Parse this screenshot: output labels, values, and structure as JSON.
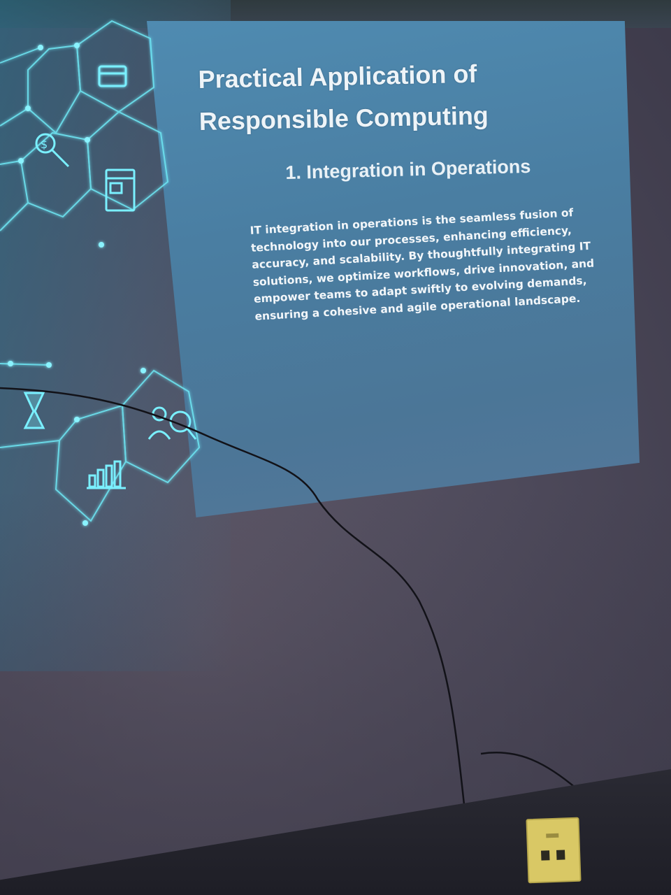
{
  "slide": {
    "title": "Practical Application of Responsible Computing",
    "subtitle": "1. Integration in Operations",
    "body": "IT integration in operations is the seamless fusion of technology into our processes, enhancing efficiency, accuracy, and scalability. By thoughtfully integrating IT solutions, we optimize workflows, drive innovation, and empower teams to adapt swiftly to evolving demands, ensuring a cohesive and agile operational landscape."
  },
  "graphic_icons": [
    "credit-card-icon",
    "dollar-search-icon",
    "browser-window-icon",
    "hourglass-icon",
    "user-search-icon",
    "bar-chart-icon"
  ],
  "colors": {
    "slide_background": "#4f8bb1",
    "hex_network": "#4fe0f0",
    "wall": "#4f4b5c",
    "socket": "#d9c865"
  }
}
